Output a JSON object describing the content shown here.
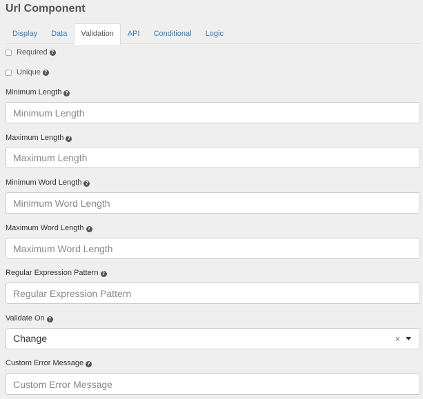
{
  "title": "Url Component",
  "tabs": [
    {
      "label": "Display",
      "active": false
    },
    {
      "label": "Data",
      "active": false
    },
    {
      "label": "Validation",
      "active": true
    },
    {
      "label": "API",
      "active": false
    },
    {
      "label": "Conditional",
      "active": false
    },
    {
      "label": "Logic",
      "active": false
    }
  ],
  "checkboxes": {
    "required": {
      "label": "Required",
      "checked": false
    },
    "unique": {
      "label": "Unique",
      "checked": false
    }
  },
  "fields": {
    "min_length": {
      "label": "Minimum Length",
      "placeholder": "Minimum Length",
      "value": ""
    },
    "max_length": {
      "label": "Maximum Length",
      "placeholder": "Maximum Length",
      "value": ""
    },
    "min_word_length": {
      "label": "Minimum Word Length",
      "placeholder": "Minimum Word Length",
      "value": ""
    },
    "max_word_length": {
      "label": "Maximum Word Length",
      "placeholder": "Maximum Word Length",
      "value": ""
    },
    "regex": {
      "label": "Regular Expression Pattern",
      "placeholder": "Regular Expression Pattern",
      "value": ""
    },
    "validate_on": {
      "label": "Validate On",
      "value": "Change"
    },
    "custom_error": {
      "label": "Custom Error Message",
      "placeholder": "Custom Error Message",
      "value": ""
    }
  },
  "icons": {
    "help": "?",
    "clear": "×"
  }
}
